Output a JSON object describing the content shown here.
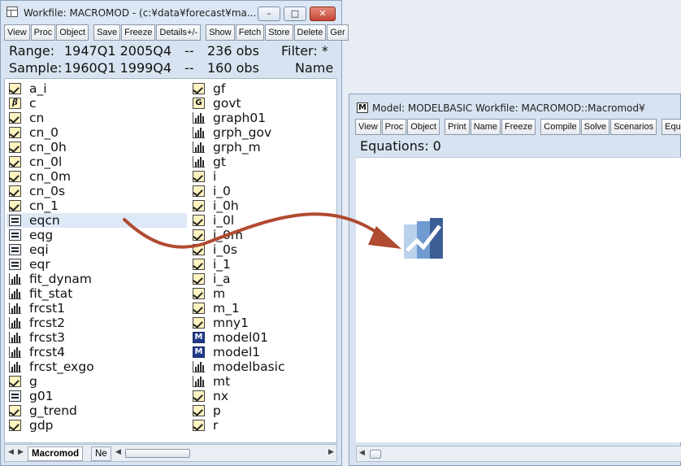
{
  "workfile": {
    "title": "Workfile: MACROMOD - (c:¥data¥forecast¥ma...",
    "toolbar": [
      "View",
      "Proc",
      "Object",
      "Save",
      "Freeze",
      "Details+/-",
      "Show",
      "Fetch",
      "Store",
      "Delete",
      "Ger"
    ],
    "range": {
      "label": "Range:",
      "value": "1947Q1 2005Q4",
      "sep": "--",
      "obs": "236 obs",
      "filter": "Filter: *"
    },
    "sample": {
      "label": "Sample:",
      "value": "1960Q1 1999Q4",
      "sep": "--",
      "obs": "160 obs",
      "name": "Name"
    },
    "objects_left": [
      {
        "name": "a_i",
        "icon": "series-icon"
      },
      {
        "name": "c",
        "icon": "coef-icon"
      },
      {
        "name": "cn",
        "icon": "series-icon"
      },
      {
        "name": "cn_0",
        "icon": "series-icon"
      },
      {
        "name": "cn_0h",
        "icon": "series-icon"
      },
      {
        "name": "cn_0l",
        "icon": "series-icon"
      },
      {
        "name": "cn_0m",
        "icon": "series-icon"
      },
      {
        "name": "cn_0s",
        "icon": "series-icon"
      },
      {
        "name": "cn_1",
        "icon": "series-icon"
      },
      {
        "name": "eqcn",
        "icon": "equation-icon",
        "selected": true
      },
      {
        "name": "eqg",
        "icon": "equation-icon"
      },
      {
        "name": "eqi",
        "icon": "equation-icon"
      },
      {
        "name": "eqr",
        "icon": "equation-icon"
      },
      {
        "name": "fit_dynam",
        "icon": "graph-icon"
      },
      {
        "name": "fit_stat",
        "icon": "graph-icon"
      },
      {
        "name": "frcst1",
        "icon": "graph-icon"
      },
      {
        "name": "frcst2",
        "icon": "graph-icon"
      },
      {
        "name": "frcst3",
        "icon": "graph-icon"
      },
      {
        "name": "frcst4",
        "icon": "graph-icon"
      },
      {
        "name": "frcst_exgo",
        "icon": "graph-icon"
      },
      {
        "name": "g",
        "icon": "series-icon"
      },
      {
        "name": "g01",
        "icon": "equation-icon"
      },
      {
        "name": "g_trend",
        "icon": "series-icon"
      },
      {
        "name": "gdp",
        "icon": "series-icon"
      }
    ],
    "objects_right": [
      {
        "name": "gf",
        "icon": "series-icon"
      },
      {
        "name": "govt",
        "icon": "group-icon"
      },
      {
        "name": "graph01",
        "icon": "graph-icon"
      },
      {
        "name": "grph_gov",
        "icon": "graph-icon"
      },
      {
        "name": "grph_m",
        "icon": "graph-icon"
      },
      {
        "name": "gt",
        "icon": "graph-icon"
      },
      {
        "name": "i",
        "icon": "series-icon"
      },
      {
        "name": "i_0",
        "icon": "series-icon"
      },
      {
        "name": "i_0h",
        "icon": "series-icon"
      },
      {
        "name": "i_0l",
        "icon": "series-icon"
      },
      {
        "name": "i_0m",
        "icon": "series-icon"
      },
      {
        "name": "i_0s",
        "icon": "series-icon"
      },
      {
        "name": "i_1",
        "icon": "series-icon"
      },
      {
        "name": "i_a",
        "icon": "series-icon"
      },
      {
        "name": "m",
        "icon": "series-icon"
      },
      {
        "name": "m_1",
        "icon": "series-icon"
      },
      {
        "name": "mny1",
        "icon": "series-icon"
      },
      {
        "name": "model01",
        "icon": "model-icon"
      },
      {
        "name": "model1",
        "icon": "model-icon"
      },
      {
        "name": "modelbasic",
        "icon": "graph-icon"
      },
      {
        "name": "mt",
        "icon": "graph-icon"
      },
      {
        "name": "nx",
        "icon": "series-icon"
      },
      {
        "name": "p",
        "icon": "series-icon"
      },
      {
        "name": "r",
        "icon": "series-icon"
      }
    ],
    "tabs": [
      "Macromod",
      "Ne"
    ]
  },
  "model": {
    "title": "Model: MODELBASIC   Workfile: MACROMOD::Macromod¥",
    "toolbar": [
      "View",
      "Proc",
      "Object",
      "Print",
      "Name",
      "Freeze",
      "Compile",
      "Solve",
      "Scenarios",
      "Equa"
    ],
    "equations_label": "Equations: 0"
  },
  "colors": {
    "arrow": "#b04a30",
    "selection": "#dde9f7",
    "window_bg": "#d7e3f0"
  }
}
